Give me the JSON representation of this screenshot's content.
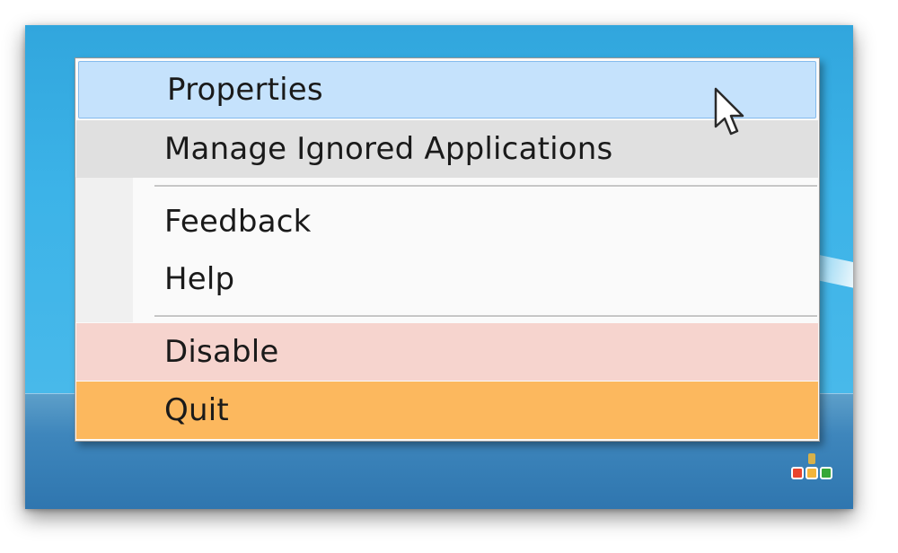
{
  "menu": {
    "items": [
      {
        "label": "Properties"
      },
      {
        "label": "Manage Ignored Applications"
      },
      {
        "label": "Feedback"
      },
      {
        "label": "Help"
      },
      {
        "label": "Disable"
      },
      {
        "label": "Quit"
      }
    ]
  },
  "colors": {
    "desktop_blue": "#3cb3e8",
    "taskbar_blue": "#3e86bc",
    "highlight_blue": "#c5e2fc",
    "manage_gray": "#e0e0e0",
    "disable_pink": "#f6d4ce",
    "quit_orange": "#fcb85e"
  },
  "icons": {
    "tray": "traffic-light-icon",
    "cursor": "mouse-pointer-icon"
  }
}
